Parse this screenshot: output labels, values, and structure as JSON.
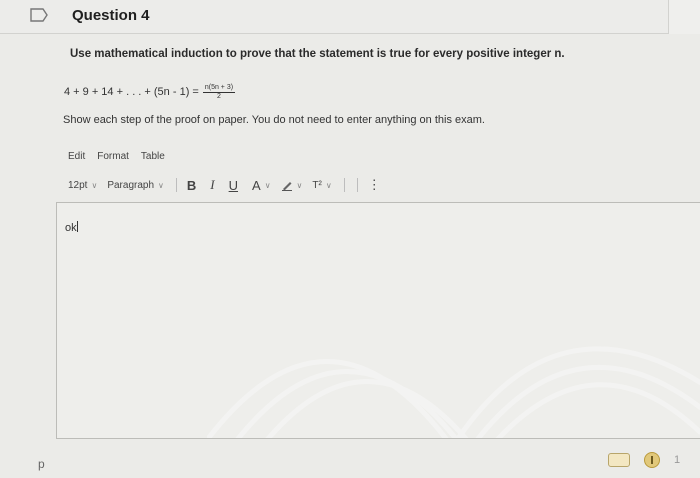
{
  "header": {
    "title": "Question 4"
  },
  "question": {
    "prompt": "Use mathematical induction to prove that the statement is true for every positive integer n.",
    "equation_left": "4 + 9 + 14 + . . . + (5n - 1) =",
    "fraction_numerator": "n(5n + 3)",
    "fraction_denominator": "2",
    "instruction": "Show each step of the proof on paper. You do not need to enter anything on this exam."
  },
  "editor": {
    "menu": [
      "Edit",
      "Format",
      "Table"
    ],
    "font_size": "12pt",
    "block_format": "Paragraph",
    "bold": "B",
    "italic": "I",
    "underline": "U",
    "text_color": "A",
    "superscript": "T²",
    "more": "⋮",
    "content": "ok"
  },
  "footer": {
    "page_marker": "p",
    "page_number": "1"
  }
}
